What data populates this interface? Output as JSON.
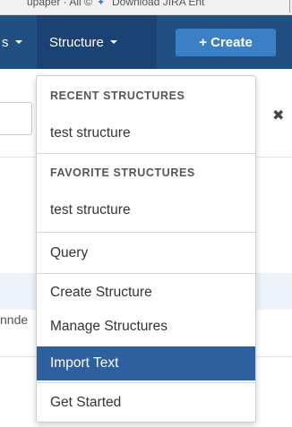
{
  "bookmarks": [
    {
      "label": "upaper · All ©"
    },
    {
      "label": "Download JIRA Ent"
    }
  ],
  "header": {
    "left_menu_label": "s",
    "structure_menu_label": "Structure",
    "create_button_label": "+ Create"
  },
  "background": {
    "partial_text": "nnde"
  },
  "dropdown": {
    "recent_header": "RECENT STRUCTURES",
    "recent_items": [
      "test structure"
    ],
    "favorite_header": "FAVORITE STRUCTURES",
    "favorite_items": [
      "test structure"
    ],
    "query_label": "Query",
    "action_items": [
      "Create Structure",
      "Manage Structures",
      "Import Text"
    ],
    "active_item": "Import Text",
    "get_started_label": "Get Started"
  },
  "colors": {
    "header_bg": "#205081",
    "active_menu_bg": "#1a4272",
    "create_button_bg": "#3b7fc4",
    "highlight_item_bg": "#2e5f9e"
  },
  "icons": {
    "close": "close-icon",
    "caret": "caret-down-icon",
    "extension": "extension-icon"
  }
}
